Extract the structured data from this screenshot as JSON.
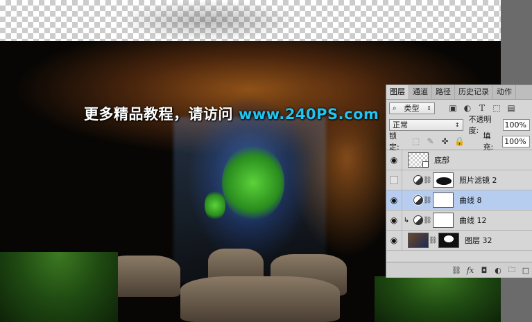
{
  "watermark": {
    "cn_text": "更多精品教程，请访问",
    "url_text": "www.240PS.com"
  },
  "panel": {
    "tabs": [
      "图层",
      "通道",
      "路径",
      "历史记录",
      "动作"
    ],
    "filter_label": "类型",
    "blend_mode": "正常",
    "opacity_label": "不透明度:",
    "opacity_value": "100%",
    "lock_label": "锁定:",
    "fill_label": "填充:",
    "fill_value": "100%",
    "layers": [
      {
        "name": "底部",
        "visible": true
      },
      {
        "name": "照片滤镜 2",
        "visible": false
      },
      {
        "name": "曲线 8",
        "visible": true,
        "selected": true
      },
      {
        "name": "曲线 12",
        "visible": true,
        "clipped": true
      },
      {
        "name": "图层 32",
        "visible": true
      }
    ],
    "icons": {
      "filter": "search-icon",
      "eye": "eye-icon",
      "link": "link-icon",
      "fx": "fx",
      "mask": "mask-icon",
      "adjustment": "adjustment-icon",
      "folder": "folder-icon",
      "new": "new-layer-icon"
    }
  },
  "colors": {
    "watermark_url": "#1fc5f2",
    "selection": "#b7cdf0"
  }
}
